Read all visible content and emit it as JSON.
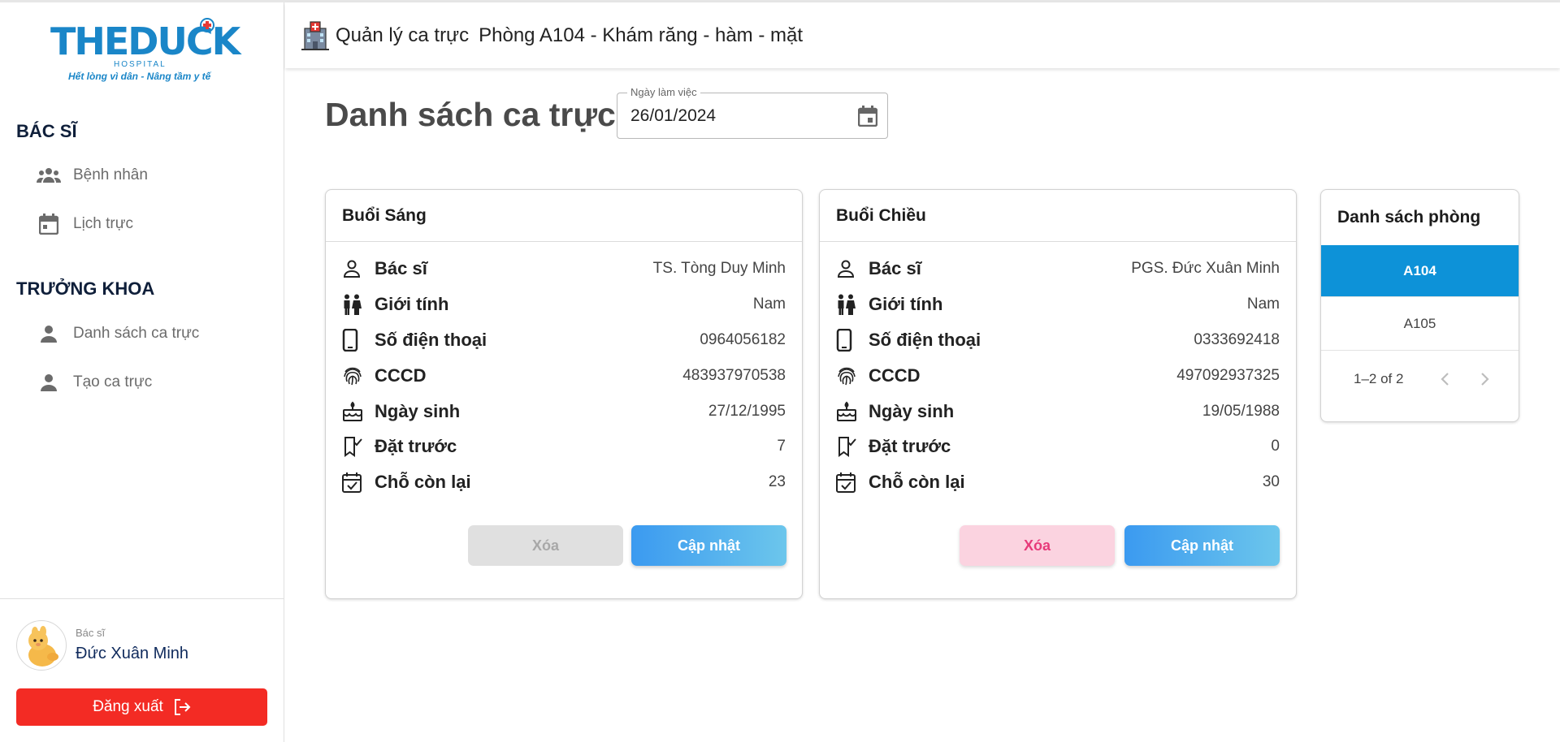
{
  "logo": {
    "main": "THEDUCK",
    "sub1": "HOSPITAL",
    "sub2": "Hết lòng vì dân - Nâng tầm y tế"
  },
  "sidebar": {
    "section1": "BÁC SĨ",
    "items1": [
      {
        "label": "Bệnh nhân",
        "icon": "people-icon"
      },
      {
        "label": "Lịch trực",
        "icon": "calendar-icon"
      }
    ],
    "section2": "TRƯỞNG KHOA",
    "items2": [
      {
        "label": "Danh sách ca trực",
        "icon": "person-icon"
      },
      {
        "label": "Tạo ca trực",
        "icon": "person-icon"
      }
    ]
  },
  "user": {
    "role": "Bác sĩ",
    "name": "Đức Xuân Minh",
    "logout_label": "Đăng xuất"
  },
  "header": {
    "app_title": "Quản lý ca trực",
    "room_title": "Phòng A104 - Khám răng - hàm - mặt"
  },
  "main": {
    "title": "Danh sách ca trực",
    "date_label": "Ngày làm việc",
    "date_value": "26/01/2024"
  },
  "labels": {
    "doctor": "Bác sĩ",
    "gender": "Giới tính",
    "phone": "Số điện thoại",
    "id": "CCCD",
    "dob": "Ngày sinh",
    "booked": "Đặt trước",
    "remaining": "Chỗ còn lại",
    "delete": "Xóa",
    "update": "Cập nhật"
  },
  "shifts": [
    {
      "title": "Buổi Sáng",
      "doctor": "TS. Tòng Duy Minh",
      "gender": "Nam",
      "phone": "0964056182",
      "id": "483937970538",
      "dob": "27/12/1995",
      "booked": "7",
      "remaining": "23",
      "delete_enabled": false
    },
    {
      "title": "Buổi Chiều",
      "doctor": "PGS. Đức Xuân Minh",
      "gender": "Nam",
      "phone": "0333692418",
      "id": "497092937325",
      "dob": "19/05/1988",
      "booked": "0",
      "remaining": "30",
      "delete_enabled": true
    }
  ],
  "rooms": {
    "title": "Danh sách phòng",
    "items": [
      {
        "label": "A104",
        "active": true
      },
      {
        "label": "A105",
        "active": false
      }
    ],
    "pagination": "1–2 of 2"
  },
  "colors": {
    "primary": "#0d92d8",
    "logout": "#f32b24",
    "brand": "#1a86c8"
  }
}
